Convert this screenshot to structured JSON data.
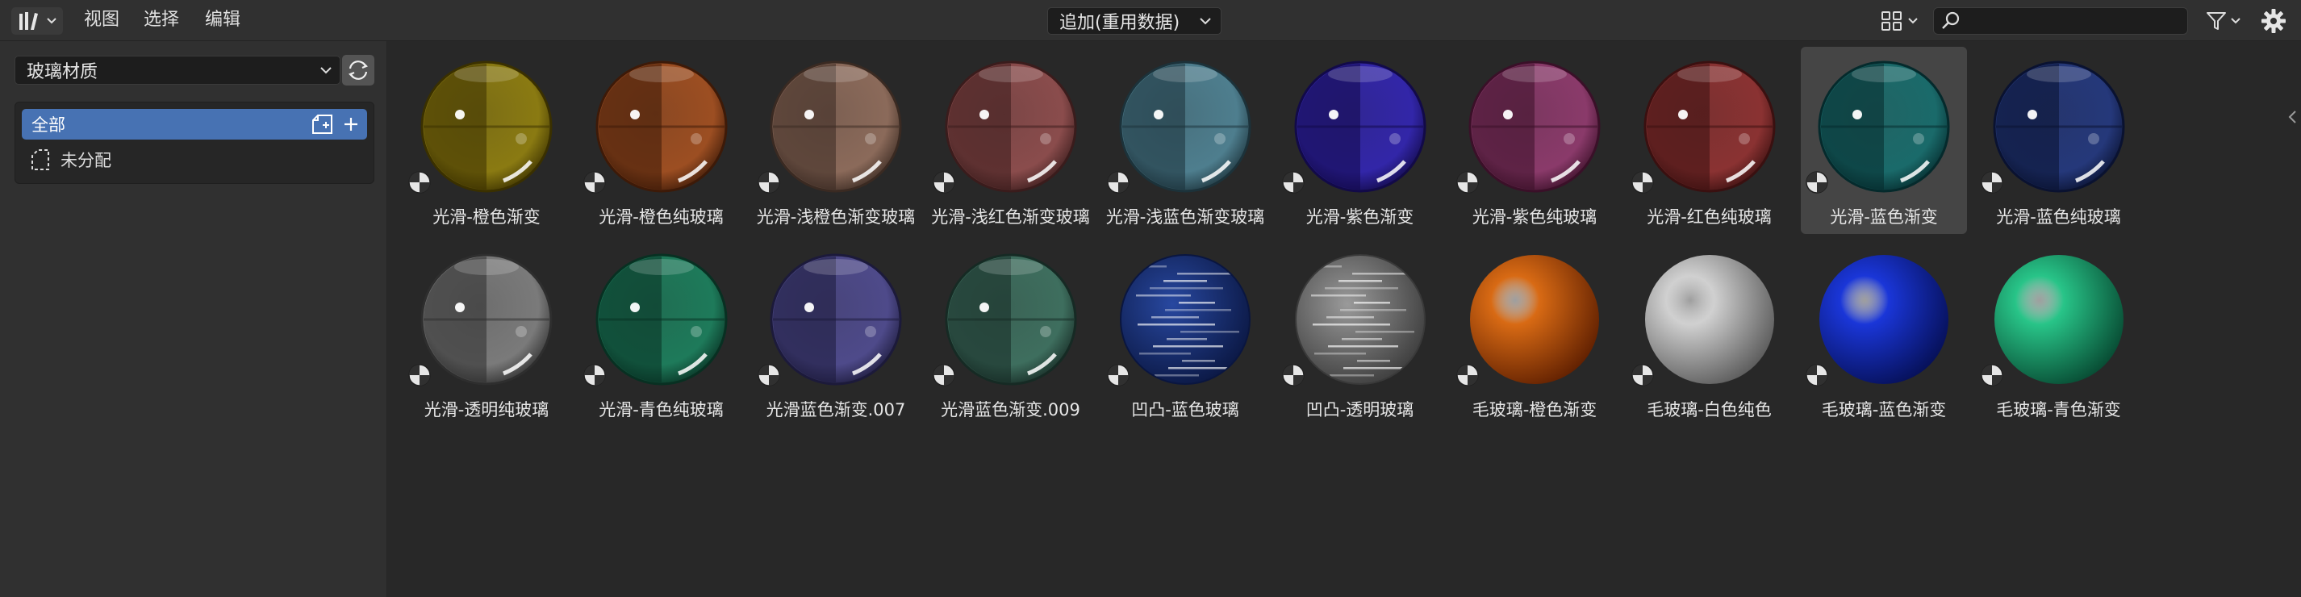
{
  "header": {
    "menus": [
      "视图",
      "选择",
      "编辑"
    ],
    "import_mode": "追加(重用数据)",
    "search_value": "",
    "search_placeholder": ""
  },
  "sidebar": {
    "library": "玻璃材质",
    "catalogs": [
      {
        "label": "全部",
        "selected": true
      },
      {
        "label": "未分配",
        "selected": false
      }
    ]
  },
  "colors": {
    "selection": "#4772b3",
    "tile_selected": "#454545"
  },
  "assets": [
    {
      "label": "光滑-橙色渐变",
      "style": "glossy-split",
      "color": "#8a7a12",
      "dark": "#3a3000",
      "selected": false
    },
    {
      "label": "光滑-橙色纯玻璃",
      "style": "glossy-split",
      "color": "#9c4e22",
      "dark": "#3d1a08",
      "selected": false
    },
    {
      "label": "光滑-浅橙色渐变玻璃",
      "style": "glossy-split",
      "color": "#8b6a5a",
      "dark": "#3a2a22",
      "selected": false
    },
    {
      "label": "光滑-浅红色渐变玻璃",
      "style": "glossy-split",
      "color": "#8a4c4c",
      "dark": "#3a1c1c",
      "selected": false
    },
    {
      "label": "光滑-浅蓝色渐变玻璃",
      "style": "glossy-split",
      "color": "#4e7e8e",
      "dark": "#1c323a",
      "selected": false
    },
    {
      "label": "光滑-紫色渐变",
      "style": "glossy-split",
      "color": "#3226a8",
      "dark": "#120a48",
      "selected": false
    },
    {
      "label": "光滑-紫色纯玻璃",
      "style": "glossy-split",
      "color": "#8a3a6a",
      "dark": "#3a1028",
      "selected": false
    },
    {
      "label": "光滑-红色纯玻璃",
      "style": "glossy-split",
      "color": "#8a3232",
      "dark": "#3a1010",
      "selected": false
    },
    {
      "label": "光滑-蓝色渐变",
      "style": "glossy-split",
      "color": "#1a6a6a",
      "dark": "#052a2c",
      "selected": true
    },
    {
      "label": "光滑-蓝色纯玻璃",
      "style": "glossy-split",
      "color": "#25387a",
      "dark": "#0a1230",
      "selected": false
    },
    {
      "label": "光滑-透明纯玻璃",
      "style": "glossy-split",
      "color": "#7a7a7a",
      "dark": "#2e2e2e",
      "selected": false
    },
    {
      "label": "光滑-青色纯玻璃",
      "style": "glossy-split",
      "color": "#1e7a5a",
      "dark": "#083022",
      "selected": false
    },
    {
      "label": "光滑蓝色渐变.007",
      "style": "glossy-split",
      "color": "#4e4a8a",
      "dark": "#1c1a3a",
      "selected": false
    },
    {
      "label": "光滑蓝色渐变.009",
      "style": "glossy-split",
      "color": "#3e6e5e",
      "dark": "#162a24",
      "selected": false
    },
    {
      "label": "凹凸-蓝色玻璃",
      "style": "bumpy",
      "color": "#2848a0",
      "dark": "#0a1640",
      "selected": false
    },
    {
      "label": "凹凸-透明玻璃",
      "style": "bumpy",
      "color": "#9a9a9a",
      "dark": "#3a3a3a",
      "selected": false
    },
    {
      "label": "毛玻璃-橙色渐变",
      "style": "frosted",
      "color": "#d86a14",
      "dark": "#5a1c00",
      "selected": false
    },
    {
      "label": "毛玻璃-白色纯色",
      "style": "frosted",
      "color": "#d0d0d0",
      "dark": "#555555",
      "selected": false
    },
    {
      "label": "毛玻璃-蓝色渐变",
      "style": "frosted",
      "color": "#1a36d8",
      "dark": "#050e50",
      "selected": false
    },
    {
      "label": "毛玻璃-青色渐变",
      "style": "frosted",
      "color": "#28c488",
      "dark": "#06442e",
      "selected": false
    }
  ]
}
